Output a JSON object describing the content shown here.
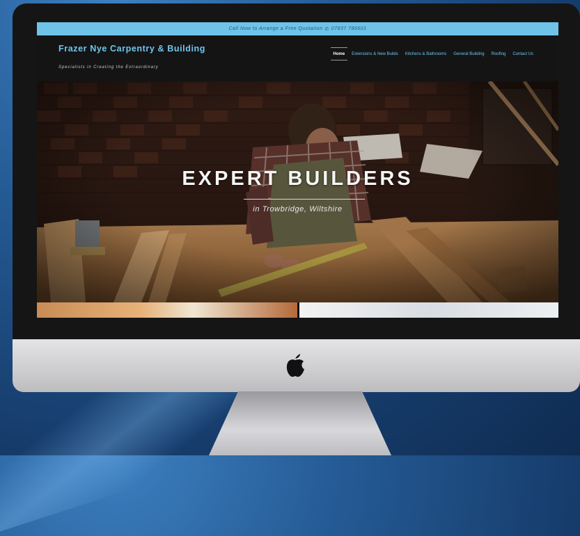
{
  "topbar": {
    "call_text": "Call Now to Arrange a Free Quotation",
    "phone_icon": "phone-icon",
    "phone": "07837 786601"
  },
  "brand": {
    "title": "Frazer Nye Carpentry & Building",
    "tagline": "Specialists in Creating the Extraordinary"
  },
  "nav": {
    "items": [
      {
        "label": "Home",
        "active": true
      },
      {
        "label": "Extensions & New Builds"
      },
      {
        "label": "Kitchens & Bathrooms"
      },
      {
        "label": "General Building"
      },
      {
        "label": "Roofing"
      },
      {
        "label": "Contact Us"
      }
    ]
  },
  "hero": {
    "title": "EXPERT BUILDERS",
    "subtitle": "in Trowbridge, Wiltshire"
  },
  "device": {
    "logo_icon": "apple-logo-icon"
  },
  "colors": {
    "accent": "#6fc6ee",
    "topbar": "#6fc2e8",
    "header_bg": "#141414"
  }
}
